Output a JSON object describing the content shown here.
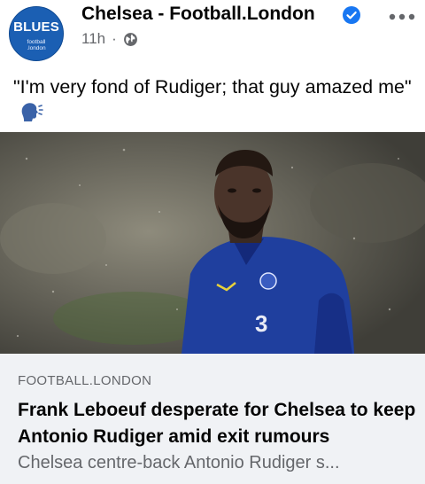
{
  "post": {
    "avatar": {
      "brand": "BLUES",
      "sub_line1": "football",
      "sub_line2": ".london"
    },
    "page_name": "Chelsea - Football.London",
    "time": "11h",
    "separator": "·",
    "caption": "\"I'm very fond of Rudiger; that guy amazed me\""
  },
  "link_preview": {
    "domain": "FOOTBALL.LONDON",
    "headline": "Frank Leboeuf desperate for Chelsea to keep Antonio Rudiger amid exit rumours",
    "description": "Chelsea centre-back Antonio Rudiger s..."
  },
  "colors": {
    "brand_blue": "#1b5fb3",
    "verified_blue": "#1877f2",
    "secondary_text": "#65676b",
    "link_box_bg": "#f0f2f5",
    "kit_blue": "#1f3f9e"
  },
  "icons": [
    "verified-badge-icon",
    "more-options-icon",
    "globe-icon",
    "speaking-head-icon"
  ]
}
